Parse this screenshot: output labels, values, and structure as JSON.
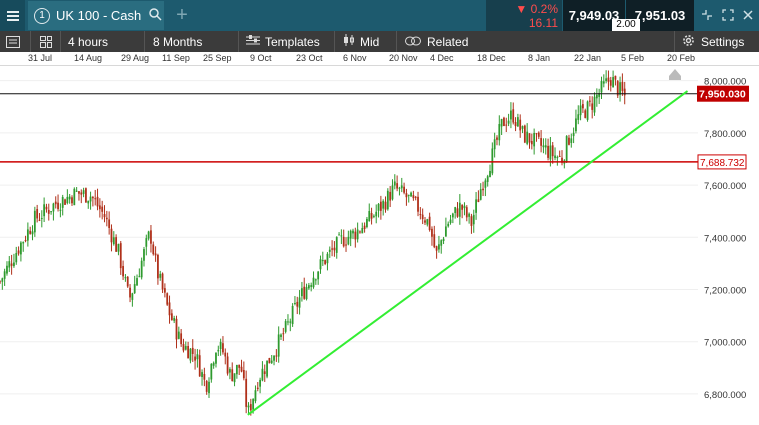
{
  "header": {
    "instrument_number": "1",
    "instrument_name": "UK 100 - Cash",
    "change_pct": "0.2%",
    "change_points": "16.11",
    "sell_price": "7,949.03",
    "buy_price": "7,951.03",
    "spread": "2.00"
  },
  "toolbar": {
    "interval": "4 hours",
    "range": "8 Months",
    "templates": "Templates",
    "price_type": "Mid",
    "related": "Related",
    "settings": "Settings"
  },
  "time_axis": [
    "31 Jul",
    "14 Aug",
    "29 Aug",
    "11 Sep",
    "25 Sep",
    "9 Oct",
    "23 Oct",
    "6 Nov",
    "20 Nov",
    "4 Dec",
    "18 Dec",
    "8 Jan",
    "22 Jan",
    "5 Feb",
    "20 Feb"
  ],
  "chart_data": {
    "type": "candlestick",
    "y_ticks": [
      6800,
      7000,
      7200,
      7400,
      7600,
      7800,
      8000
    ],
    "y_tick_labels": [
      "6,800.000",
      "7,000.000",
      "7,200.000",
      "7,400.000",
      "7,600.000",
      "7,800.000",
      "8,000.000"
    ],
    "ylim": [
      6700,
      8060
    ],
    "current_price": 7950.03,
    "current_price_label": "7,950.030",
    "horizontal_line": 7688.732,
    "horizontal_line_label": "7,688.732",
    "trendline": {
      "start": [
        0.355,
        6720
      ],
      "end": [
        0.985,
        7960
      ]
    },
    "path": [
      [
        0,
        7230
      ],
      [
        0.02,
        7330
      ],
      [
        0.05,
        7470
      ],
      [
        0.08,
        7530
      ],
      [
        0.11,
        7570
      ],
      [
        0.13,
        7560
      ],
      [
        0.15,
        7480
      ],
      [
        0.17,
        7340
      ],
      [
        0.185,
        7160
      ],
      [
        0.2,
        7280
      ],
      [
        0.215,
        7420
      ],
      [
        0.225,
        7270
      ],
      [
        0.24,
        7130
      ],
      [
        0.26,
        6990
      ],
      [
        0.28,
        6950
      ],
      [
        0.295,
        6830
      ],
      [
        0.31,
        6990
      ],
      [
        0.32,
        6960
      ],
      [
        0.33,
        6870
      ],
      [
        0.345,
        6910
      ],
      [
        0.355,
        6720
      ],
      [
        0.37,
        6860
      ],
      [
        0.39,
        6950
      ],
      [
        0.41,
        7050
      ],
      [
        0.43,
        7170
      ],
      [
        0.45,
        7260
      ],
      [
        0.47,
        7330
      ],
      [
        0.49,
        7390
      ],
      [
        0.51,
        7420
      ],
      [
        0.53,
        7470
      ],
      [
        0.55,
        7530
      ],
      [
        0.565,
        7590
      ],
      [
        0.58,
        7560
      ],
      [
        0.6,
        7510
      ],
      [
        0.615,
        7450
      ],
      [
        0.625,
        7330
      ],
      [
        0.64,
        7450
      ],
      [
        0.66,
        7520
      ],
      [
        0.675,
        7450
      ],
      [
        0.69,
        7600
      ],
      [
        0.705,
        7710
      ],
      [
        0.72,
        7840
      ],
      [
        0.735,
        7870
      ],
      [
        0.75,
        7790
      ],
      [
        0.77,
        7760
      ],
      [
        0.79,
        7720
      ],
      [
        0.805,
        7700
      ],
      [
        0.815,
        7780
      ],
      [
        0.83,
        7870
      ],
      [
        0.845,
        7900
      ],
      [
        0.86,
        7960
      ],
      [
        0.875,
        8010
      ],
      [
        0.885,
        7970
      ],
      [
        0.895,
        7940
      ]
    ]
  }
}
